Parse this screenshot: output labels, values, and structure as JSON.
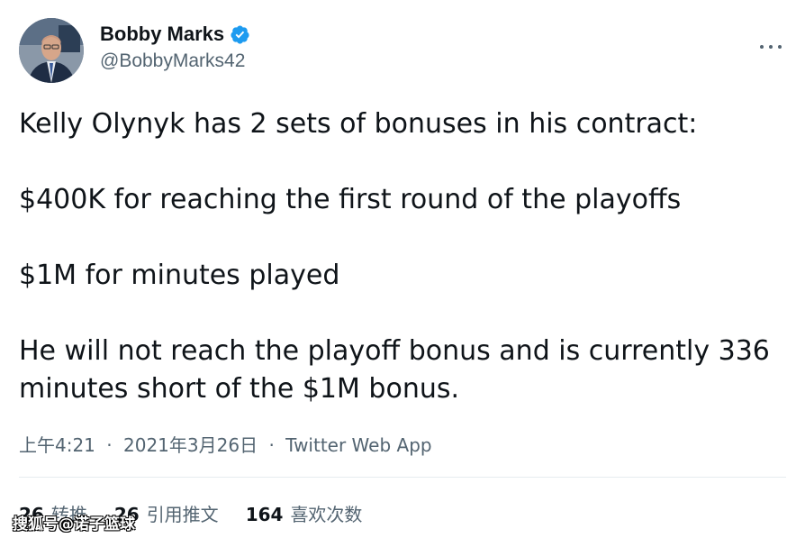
{
  "author": {
    "display_name": "Bobby Marks",
    "handle": "@BobbyMarks42",
    "verified": true
  },
  "tweet": {
    "lines": [
      "Kelly Olynyk has 2 sets of bonuses in his contract:",
      "$400K for reaching the first round of the playoffs",
      "$1M for minutes played",
      "He will not reach the playoff bonus and is currently 336 minutes short of the $1M bonus."
    ]
  },
  "meta": {
    "time": "上午4:21",
    "date": "2021年3月26日",
    "source": "Twitter Web App",
    "separator": "·"
  },
  "stats": [
    {
      "count": "26",
      "label": "转推"
    },
    {
      "count": "26",
      "label": "引用推文"
    },
    {
      "count": "164",
      "label": "喜欢次数"
    }
  ],
  "watermark": "搜狐号@诺子篮球",
  "colors": {
    "verified_badge": "#1d9bf0",
    "text_primary": "#0f1419",
    "text_secondary": "#536471"
  },
  "icons": [
    "verified-badge-icon",
    "more-options-icon"
  ]
}
